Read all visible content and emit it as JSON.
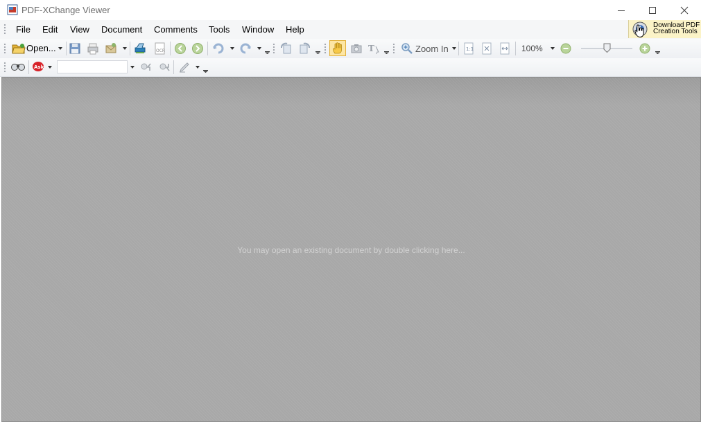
{
  "window": {
    "title": "PDF-XChange Viewer",
    "minimize_icon": "minimize-icon",
    "maximize_icon": "maximize-icon",
    "close_icon": "close-icon"
  },
  "menu": {
    "items": [
      "File",
      "Edit",
      "View",
      "Document",
      "Comments",
      "Tools",
      "Window",
      "Help"
    ]
  },
  "promo": {
    "line1": "Download PDF",
    "line2": "Creation Tools"
  },
  "toolbar1": {
    "open_label": "Open...",
    "zoom_in_label": "Zoom In",
    "zoom_value": "100%",
    "zoom_slider_level": 0.5
  },
  "toolbar2": {
    "search_value": ""
  },
  "document": {
    "hint": "You may open an existing document by double clicking here..."
  },
  "colors": {
    "accent_hand_tool": "#f7c948",
    "promo_bg": "#fbf3c7",
    "doc_bg": "#a5a5a5"
  }
}
